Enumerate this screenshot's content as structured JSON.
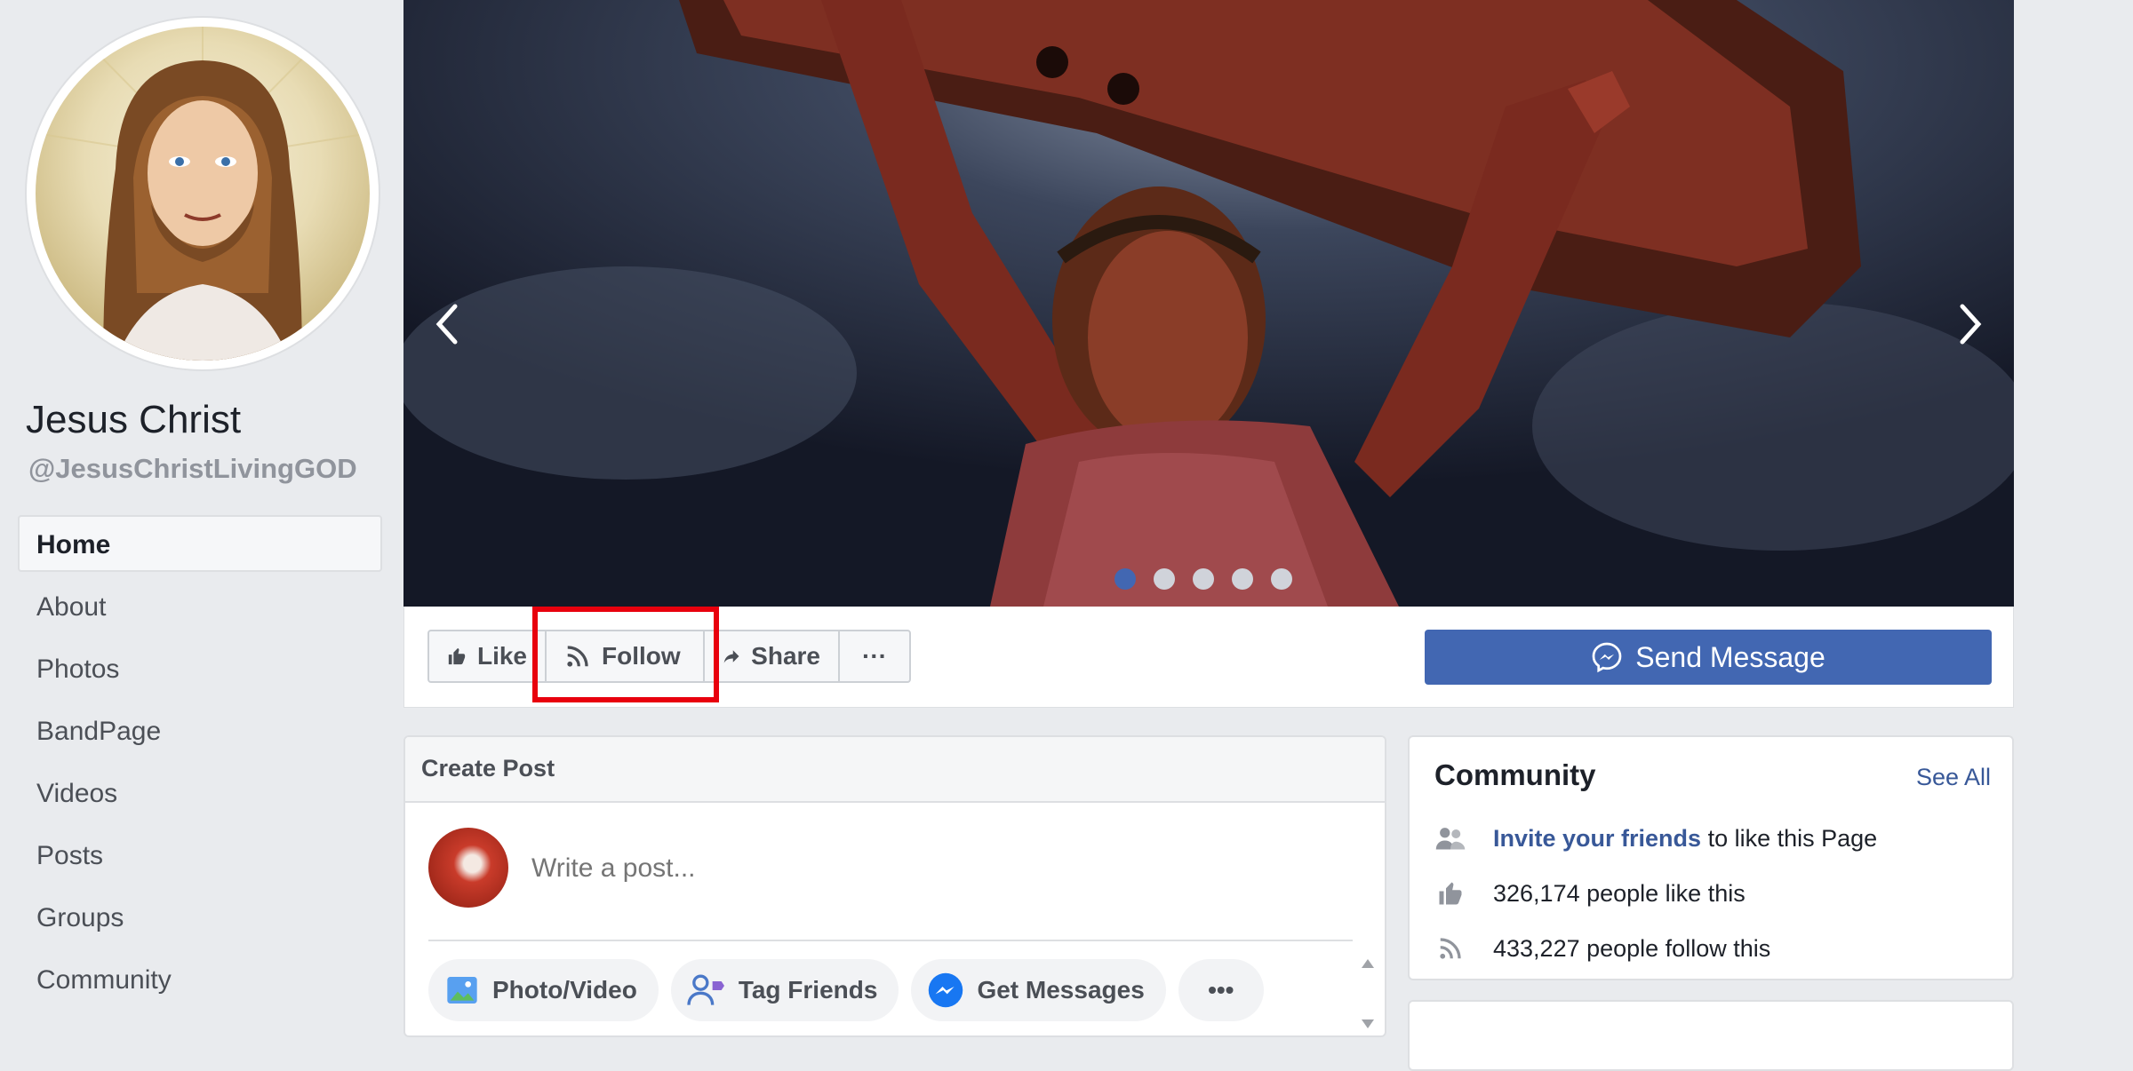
{
  "page": {
    "name": "Jesus Christ",
    "handle": "@JesusChristLivingGOD"
  },
  "nav": {
    "items": [
      {
        "label": "Home",
        "active": true
      },
      {
        "label": "About"
      },
      {
        "label": "Photos"
      },
      {
        "label": "BandPage"
      },
      {
        "label": "Videos"
      },
      {
        "label": "Posts"
      },
      {
        "label": "Groups"
      },
      {
        "label": "Community"
      }
    ]
  },
  "cover": {
    "slide_count": 5,
    "active_slide": 1
  },
  "actions": {
    "like": "Like",
    "follow": "Follow",
    "share": "Share",
    "more": "···",
    "send_message": "Send Message"
  },
  "create_post": {
    "title": "Create Post",
    "placeholder": "Write a post...",
    "buttons": {
      "photo_video": "Photo/Video",
      "tag_friends": "Tag Friends",
      "get_messages": "Get Messages",
      "more": "•••"
    }
  },
  "community": {
    "title": "Community",
    "see_all": "See All",
    "invite_link": "Invite your friends",
    "invite_rest": " to like this Page",
    "likes": "326,174 people like this",
    "follows": "433,227 people follow this"
  },
  "colors": {
    "accent": "#4267b2",
    "link": "#385898",
    "highlight": "#e8000d"
  }
}
